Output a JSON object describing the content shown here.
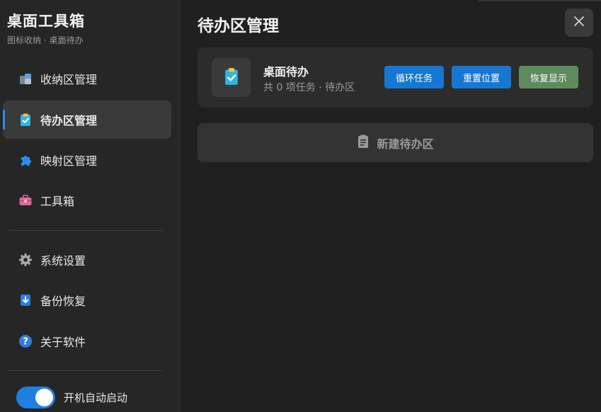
{
  "app": {
    "title": "桌面工具箱",
    "subtitle": "图标收纳 · 桌面待办"
  },
  "sidebar": {
    "items": [
      {
        "label": "收纳区管理",
        "icon": "storage-box-icon",
        "active": false
      },
      {
        "label": "待办区管理",
        "icon": "clipboard-check-icon",
        "active": true
      },
      {
        "label": "映射区管理",
        "icon": "puzzle-icon",
        "active": false
      },
      {
        "label": "工具箱",
        "icon": "toolbox-icon",
        "active": false
      },
      {
        "label": "系统设置",
        "icon": "gear-icon",
        "active": false
      },
      {
        "label": "备份恢复",
        "icon": "backup-icon",
        "active": false
      },
      {
        "label": "关于软件",
        "icon": "help-icon",
        "active": false
      }
    ],
    "autostart": {
      "label": "开机自动启动",
      "enabled": true
    }
  },
  "main": {
    "title": "待办区管理",
    "card": {
      "title": "桌面待办",
      "subtitle": "共 0 项任务 · 待办区",
      "buttons": [
        {
          "label": "循环任务",
          "color": "#1677d2"
        },
        {
          "label": "重置位置",
          "color": "#1677d2"
        },
        {
          "label": "恢复显示",
          "color": "#5e8a5e"
        }
      ]
    },
    "new_button": {
      "label": "新建待办区",
      "icon": "notepad-icon"
    }
  },
  "colors": {
    "accent": "#2d8cf0",
    "background": "#202020",
    "sidebar": "#262626"
  }
}
